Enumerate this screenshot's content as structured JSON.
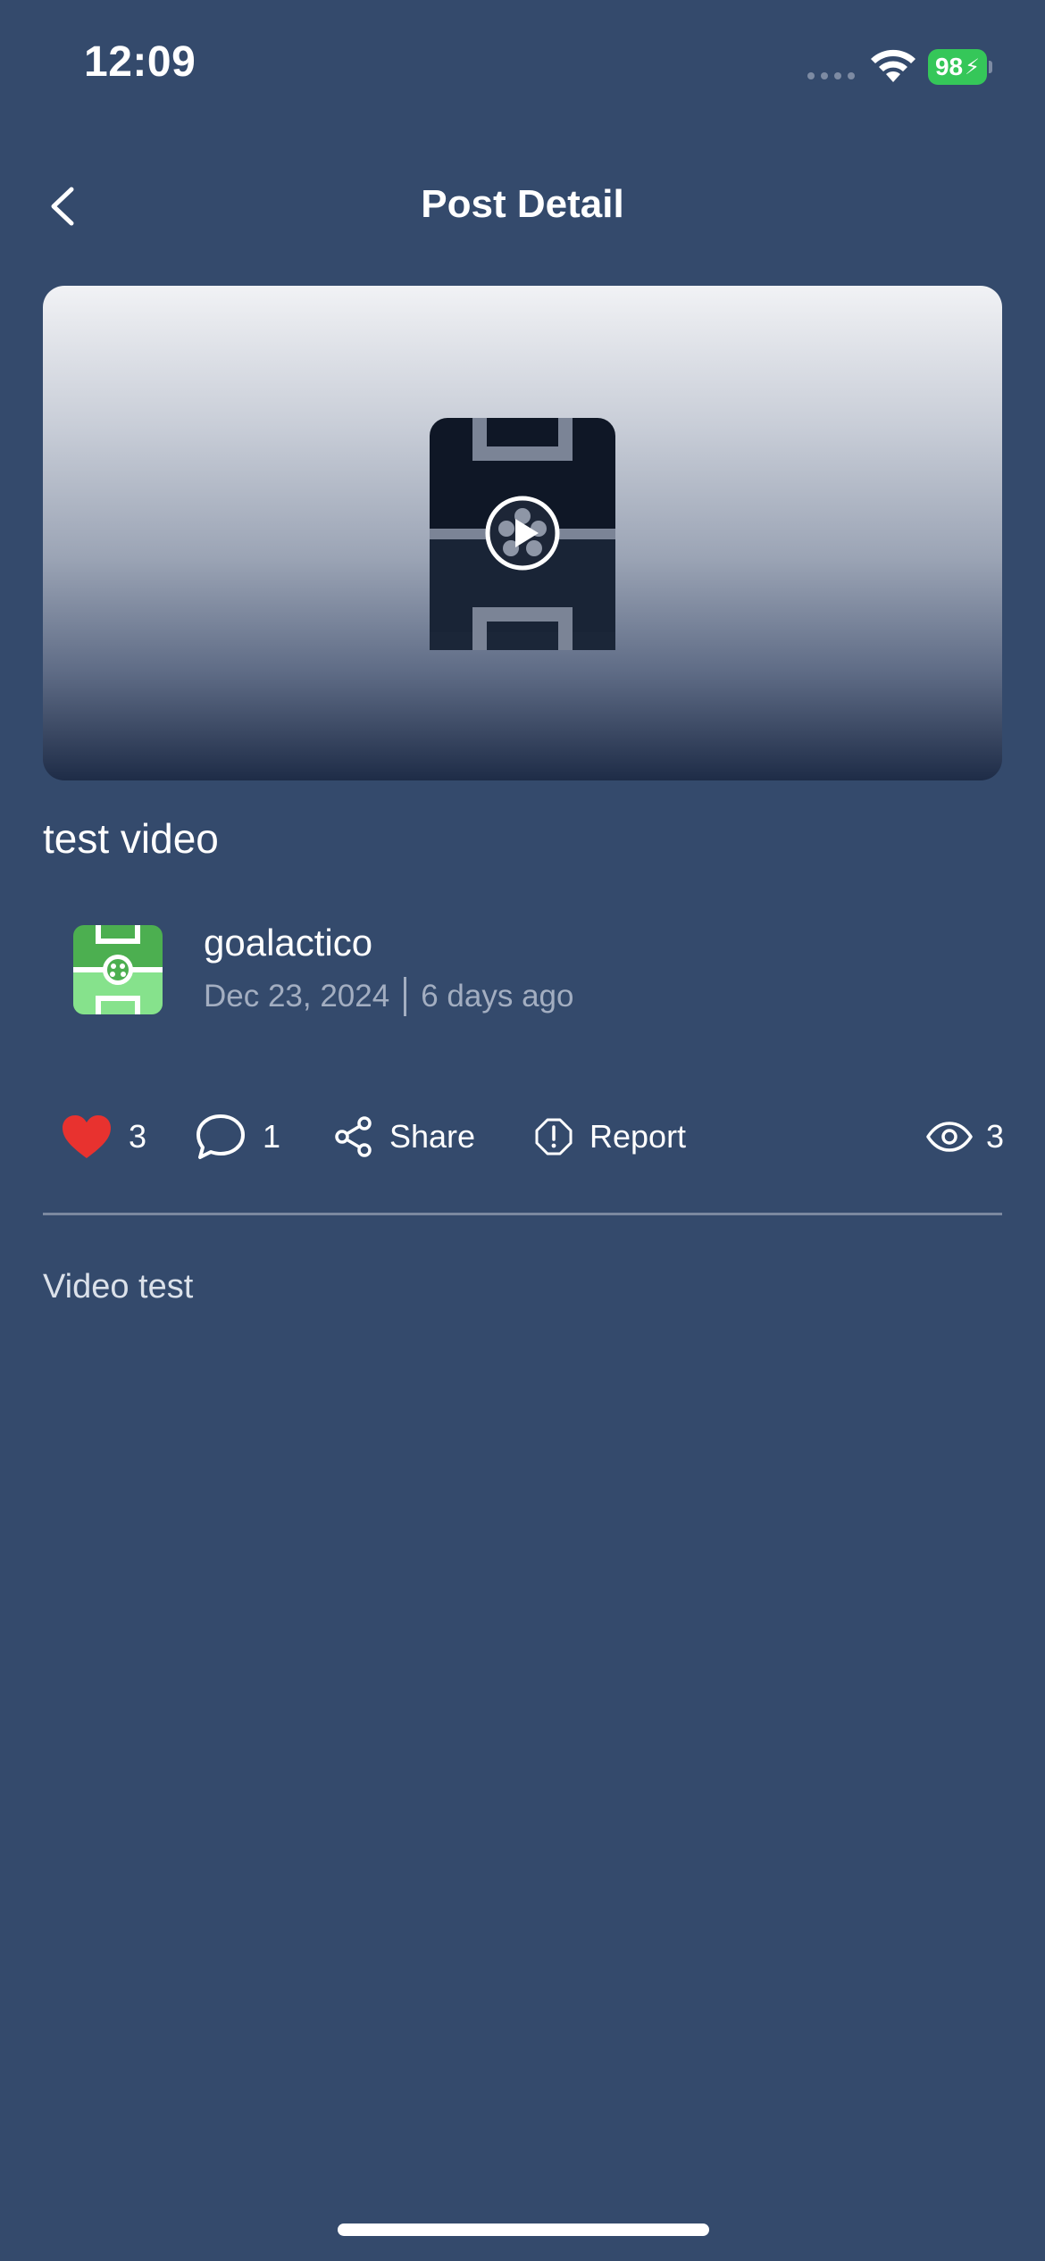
{
  "status_bar": {
    "time": "12:09",
    "battery_level": "98",
    "battery_color": "#35c759",
    "icons": [
      "cellular-signal-icon",
      "wifi-icon",
      "battery-charging-icon"
    ]
  },
  "nav": {
    "title": "Post Detail",
    "back_icon": "chevron-left-icon"
  },
  "video": {
    "thumbnail_icon": "soccer-pitch-icon",
    "play_icon": "play-icon"
  },
  "post": {
    "title": "test video",
    "body": "Video test"
  },
  "author": {
    "name": "goalactico",
    "date": "Dec 23, 2024",
    "relative": "6 days ago",
    "avatar_color": "#4caf50"
  },
  "actions": {
    "likes": "3",
    "like_color": "#e8322f",
    "comments": "1",
    "share_label": "Share",
    "report_label": "Report",
    "views": "3"
  },
  "colors": {
    "background": "#344a6c",
    "muted_text": "#a3aec1"
  }
}
